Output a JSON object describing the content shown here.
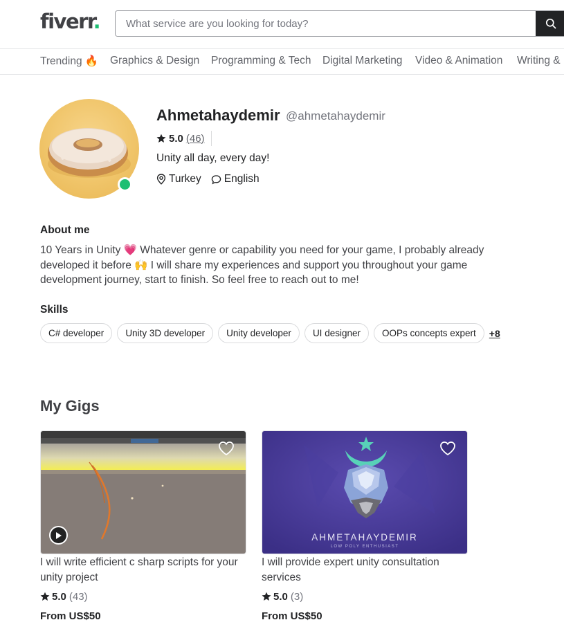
{
  "header": {
    "logo_text": "fiverr",
    "logo_dot": ".",
    "search_placeholder": "What service are you looking for today?"
  },
  "categories": [
    {
      "label": "Trending 🔥"
    },
    {
      "label": "Graphics & Design"
    },
    {
      "label": "Programming & Tech"
    },
    {
      "label": "Digital Marketing"
    },
    {
      "label": "Video & Animation"
    },
    {
      "label": "Writing &"
    }
  ],
  "profile": {
    "name": "Ahmetahaydemir",
    "handle": "@ahmetahaydemir",
    "rating": "5.0",
    "rating_count": "(46)",
    "tagline": "Unity all day, every day!",
    "location": "Turkey",
    "language": "English"
  },
  "about": {
    "title": "About me",
    "text": "10 Years in Unity 💗 Whatever genre or capability you need for your game, I probably already developed it before 🙌 I will share my experiences and support you throughout your game development journey, start to finish. So feel free to reach out to me!"
  },
  "skills": {
    "title": "Skills",
    "items": [
      "C# developer",
      "Unity 3D developer",
      "Unity developer",
      "UI designer",
      "OOPs concepts expert"
    ],
    "more": "+8"
  },
  "gigs": {
    "title": "My Gigs",
    "items": [
      {
        "title": "I will write efficient c sharp scripts for your unity project",
        "rating": "5.0",
        "count": "(43)",
        "price": "From US$50"
      },
      {
        "title": "I will provide expert unity consultation services",
        "rating": "5.0",
        "count": "(3)",
        "price": "From US$50",
        "image_brand": "AHMETAHAYDEMIR",
        "image_sub": "LOW POLY ENTHUSIAST"
      }
    ]
  },
  "colors": {
    "brand_green": "#1dbf73",
    "text_dark": "#222325",
    "text_gray": "#74767e"
  }
}
